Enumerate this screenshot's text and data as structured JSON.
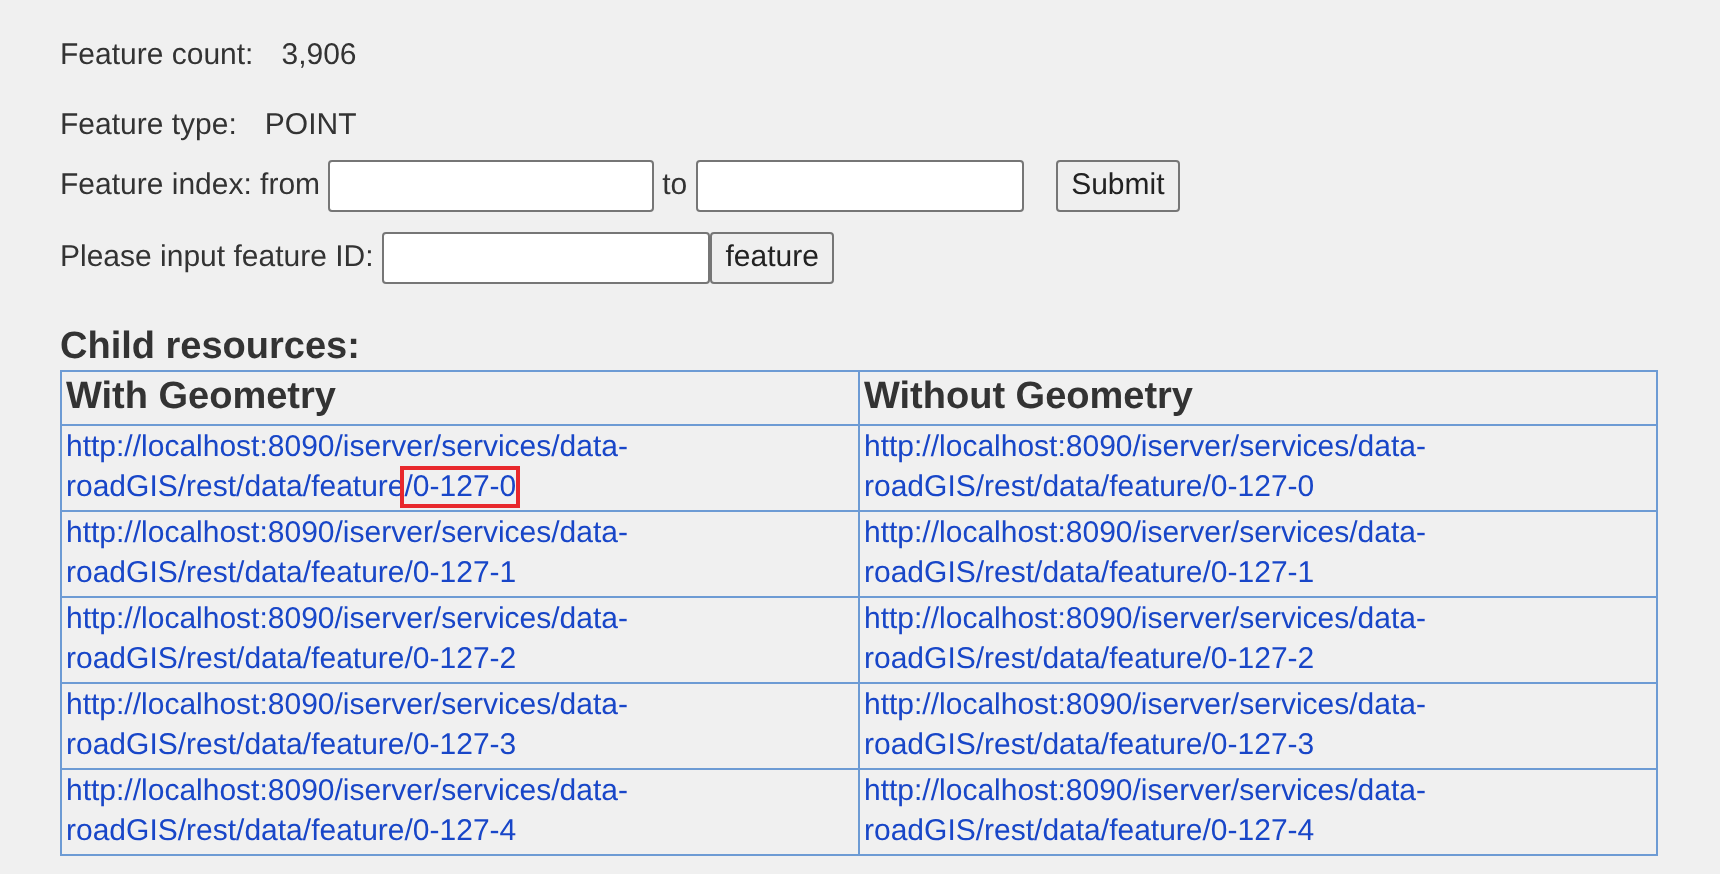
{
  "feature_count": {
    "label": "Feature count:",
    "value": "3,906"
  },
  "feature_type": {
    "label": "Feature type:",
    "value": "POINT"
  },
  "index_form": {
    "label": "Feature index: from",
    "to_label": "to",
    "button": "Submit"
  },
  "id_form": {
    "label": "Please input feature ID:",
    "button": "feature"
  },
  "child_resources": {
    "title": "Child resources:",
    "columns": [
      "With Geometry",
      "Without Geometry"
    ],
    "rows": [
      {
        "with_geometry": "http://localhost:8090/iserver/services/data-roadGIS/rest/data/feature/0-127-0",
        "without_geometry": "http://localhost:8090/iserver/services/data-roadGIS/rest/data/feature/0-127-0",
        "highlighted": true
      },
      {
        "with_geometry": "http://localhost:8090/iserver/services/data-roadGIS/rest/data/feature/0-127-1",
        "without_geometry": "http://localhost:8090/iserver/services/data-roadGIS/rest/data/feature/0-127-1",
        "highlighted": false
      },
      {
        "with_geometry": "http://localhost:8090/iserver/services/data-roadGIS/rest/data/feature/0-127-2",
        "without_geometry": "http://localhost:8090/iserver/services/data-roadGIS/rest/data/feature/0-127-2",
        "highlighted": false
      },
      {
        "with_geometry": "http://localhost:8090/iserver/services/data-roadGIS/rest/data/feature/0-127-3",
        "without_geometry": "http://localhost:8090/iserver/services/data-roadGIS/rest/data/feature/0-127-3",
        "highlighted": false
      },
      {
        "with_geometry": "http://localhost:8090/iserver/services/data-roadGIS/rest/data/feature/0-127-4",
        "without_geometry": "http://localhost:8090/iserver/services/data-roadGIS/rest/data/feature/0-127-4",
        "highlighted": false
      }
    ]
  }
}
